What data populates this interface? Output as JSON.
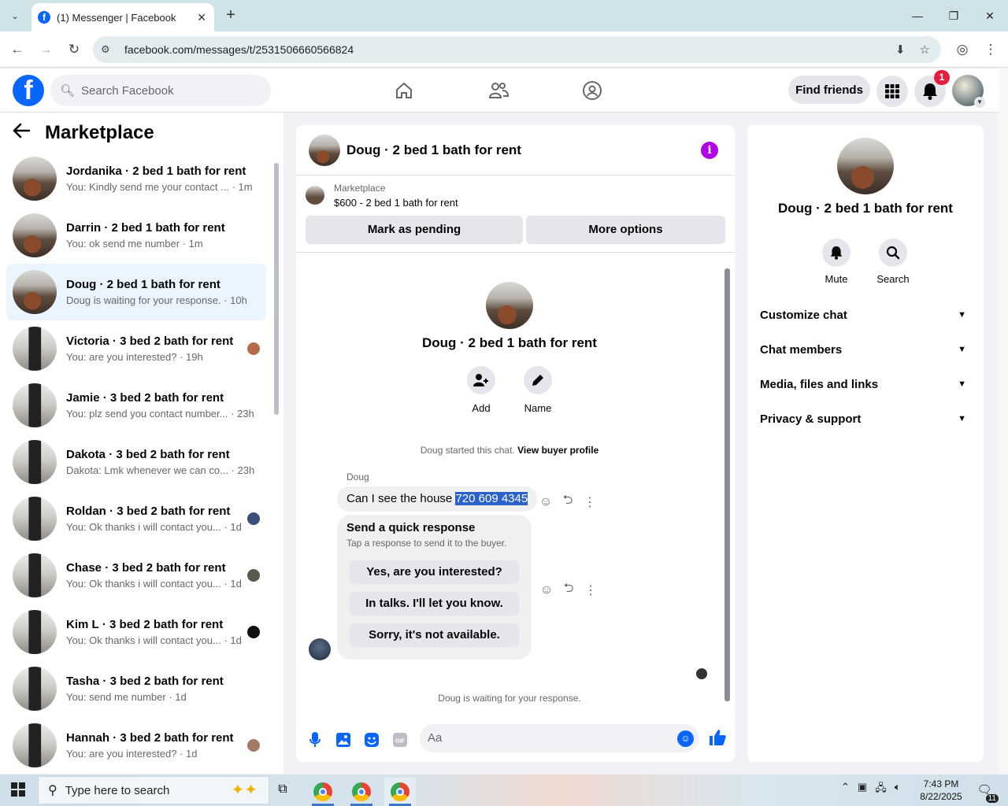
{
  "browser": {
    "tab_title": "(1) Messenger | Facebook",
    "url": "facebook.com/messages/t/2531506660566824",
    "icons": [
      "tab-dropdown-icon",
      "facebook-favicon",
      "close-tab-icon",
      "new-tab-icon",
      "minimize-icon",
      "restore-icon",
      "close-window-icon",
      "back-icon",
      "forward-icon",
      "reload-icon",
      "site-settings-icon",
      "install-app-icon",
      "bookmark-star-icon",
      "profile-icon",
      "menu-icon"
    ]
  },
  "fb_header": {
    "logo": "f",
    "search_placeholder": "Search Facebook",
    "find_friends": "Find friends",
    "notification_count": "1",
    "icons": [
      "home-icon",
      "friends-icon",
      "groups-icon",
      "menu-grid-icon",
      "bell-icon",
      "account-avatar"
    ]
  },
  "left": {
    "title": "Marketplace",
    "conversations": [
      {
        "name": "Jordanika",
        "listing": "2 bed 1 bath for rent",
        "snippet": "You: Kindly send me your contact ...",
        "time": "1m",
        "avatar": "kitchen"
      },
      {
        "name": "Darrin",
        "listing": "2 bed 1 bath for rent",
        "snippet": "You: ok send me number",
        "time": "1m",
        "avatar": "kitchen"
      },
      {
        "name": "Doug",
        "listing": "2 bed 1 bath for rent",
        "snippet": "Doug is waiting for your response.",
        "time": "10h",
        "avatar": "kitchen",
        "selected": true
      },
      {
        "name": "Victoria",
        "listing": "3 bed 2 bath for rent",
        "snippet": "You: are you interested?",
        "time": "19h",
        "avatar": "oven",
        "mini": "#b56a4a"
      },
      {
        "name": "Jamie",
        "listing": "3 bed 2 bath for rent",
        "snippet": "You: plz send you contact number...",
        "time": "23h",
        "avatar": "oven"
      },
      {
        "name": "Dakota",
        "listing": "3 bed 2 bath for rent",
        "snippet": "Dakota: Lmk whenever we can co...",
        "time": "23h",
        "avatar": "oven"
      },
      {
        "name": "Roldan",
        "listing": "3 bed 2 bath for rent",
        "snippet": "You: Ok thanks i will contact you...",
        "time": "1d",
        "avatar": "oven",
        "mini": "#3c4f7a"
      },
      {
        "name": "Chase",
        "listing": "3 bed 2 bath for rent",
        "snippet": "You: Ok thanks i will contact you...",
        "time": "1d",
        "avatar": "oven",
        "mini": "#555c4a"
      },
      {
        "name": "Kim L",
        "listing": "3 bed 2 bath for rent",
        "snippet": "You: Ok thanks i will contact you...",
        "time": "1d",
        "avatar": "oven",
        "mini": "#111111"
      },
      {
        "name": "Tasha",
        "listing": "3 bed 2 bath for rent",
        "snippet": "You: send me number",
        "time": "1d",
        "avatar": "oven"
      },
      {
        "name": "Hannah",
        "listing": "3 bed 2 bath for rent",
        "snippet": "You: are you interested?",
        "time": "1d",
        "avatar": "oven",
        "mini": "#a37a63"
      }
    ]
  },
  "chat": {
    "title": "Doug · 2 bed 1 bath for rent",
    "marketplace_label": "Marketplace",
    "listing_line": "$600 - 2 bed 1 bath for rent",
    "mark_pending": "Mark as pending",
    "more_options": "More options",
    "profile_name": "Doug · 2 bed 1 bath for rent",
    "add_label": "Add",
    "name_label": "Name",
    "started_text": "Doug started this chat.",
    "view_buyer": "View buyer profile",
    "sender": "Doug",
    "message_text": "Can I see the house ",
    "message_phone": "720 609 4345",
    "quick_title": "Send a quick response",
    "quick_sub": "Tap a response to send it to the buyer.",
    "quick_replies": [
      "Yes, are you interested?",
      "In talks. I'll let you know.",
      "Sorry, it's not available."
    ],
    "waiting": "Doug is waiting for your response.",
    "input_placeholder": "Aa",
    "accent": "#0866ff"
  },
  "right": {
    "name": "Doug · 2 bed 1 bath for rent",
    "mute": "Mute",
    "search": "Search",
    "sections": [
      "Customize chat",
      "Chat members",
      "Media, files and links",
      "Privacy & support"
    ]
  },
  "taskbar": {
    "search_placeholder": "Type here to search",
    "time": "7:43 PM",
    "date": "8/22/2025",
    "notification_count": "11"
  }
}
